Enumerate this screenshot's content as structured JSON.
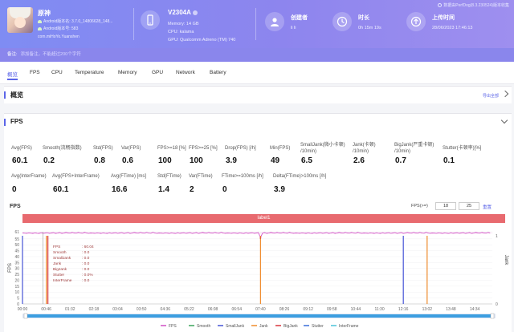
{
  "header": {
    "app_name": "原神",
    "version_line": "Android版本名: 3.7.0_14806628_148...",
    "version_code": "Android版本号: 583",
    "package": "com.miHoYo.Yuanshen",
    "device_name": "V2304A",
    "memory": "Memory: 14 GB",
    "cpu": "CPU: kalama",
    "gpu": "GPU: Qualcomm Adreno (TM) 740",
    "creator_label": "创建者",
    "creator_value": "li li",
    "duration_label": "时长",
    "duration_value": "0h 15m 19s",
    "upload_label": "上传时间",
    "upload_value": "28/06/2023 17:46:13",
    "watermark": "数据由PerfDog(8.3.230524)版本收集",
    "note_label": "备注:",
    "note_hint": "添加备注，不能超过200个字符",
    "accent_color": "#8a86ec"
  },
  "tabs": [
    "概览",
    "FPS",
    "CPU",
    "Temperature",
    "Memory",
    "GPU",
    "Network",
    "Battery"
  ],
  "overview": {
    "title": "概览",
    "export_label": "导出全部"
  },
  "fps_section": {
    "title": "FPS",
    "metrics_row1": [
      {
        "label": "Avg(FPS)",
        "value": "60.1"
      },
      {
        "label": "Smooth(流畅指数)",
        "value": "0.2"
      },
      {
        "label": "Std(FPS)",
        "value": "0.8"
      },
      {
        "label": "Var(FPS)",
        "value": "0.6"
      },
      {
        "label": "FPS>=18 [%]",
        "value": "100"
      },
      {
        "label": "FPS>=25 [%]",
        "value": "100"
      },
      {
        "label": "Drop(FPS) [/h]",
        "value": "3.9"
      },
      {
        "label": "Min(FPS)",
        "value": "49"
      },
      {
        "label": "SmallJank(微小卡顿)\n/10min)",
        "value": "6.5"
      },
      {
        "label": "Jank(卡顿)\n/10min)",
        "value": "2.6"
      },
      {
        "label": "BigJank(严重卡顿)\n/10min)",
        "value": "0.7"
      },
      {
        "label": "Stutter(卡顿率)[%]",
        "value": "0.1"
      }
    ],
    "metrics_row2": [
      {
        "label": "Avg(InterFrame)",
        "value": "0"
      },
      {
        "label": "Avg(FPS+InterFrame)",
        "value": "60.1"
      },
      {
        "label": "Avg(FTime) [ms]",
        "value": "16.6"
      },
      {
        "label": "Std(FTime)",
        "value": "1.4"
      },
      {
        "label": "Var(FTime)",
        "value": "2"
      },
      {
        "label": "FTime>=100ms [/h]",
        "value": "0"
      },
      {
        "label": "Delta(FTime)>100ms [/h]",
        "value": "3.9"
      }
    ]
  },
  "chart": {
    "title": "FPS",
    "fps_filter_label": "FPS(>=)",
    "fps_filter_values": [
      "18",
      "25"
    ],
    "reset_label": "重置",
    "label_bar": "label1"
  },
  "chart_data": {
    "type": "line",
    "ylabel_left": "FPS",
    "ylabel_right": "Jank",
    "y_ticks_left": [
      "61",
      "55",
      "50",
      "45",
      "40",
      "35",
      "30",
      "25",
      "20",
      "15",
      "10",
      "5",
      "0"
    ],
    "y_ticks_right": [
      "1",
      "0"
    ],
    "x_ticks": [
      "00:00",
      "00:46",
      "01:32",
      "02:18",
      "03:04",
      "03:50",
      "04:36",
      "05:22",
      "06:08",
      "06:54",
      "07:40",
      "08:26",
      "09:12",
      "09:58",
      "10:44",
      "11:30",
      "12:16",
      "13:02",
      "13:48",
      "14:34"
    ],
    "series": [
      {
        "name": "FPS",
        "color": "#d14fc4",
        "baseline": 60,
        "dips": [
          {
            "x": "00:46",
            "value": 49
          },
          {
            "x": "07:40",
            "value": 56
          },
          {
            "x": "13:02",
            "value": 58
          }
        ]
      },
      {
        "name": "Smooth",
        "color": "#3aa45a"
      },
      {
        "name": "SmallJank",
        "color": "#4554d6"
      },
      {
        "name": "Jank",
        "color": "#ef8a2b"
      },
      {
        "name": "BigJank",
        "color": "#d8363c"
      },
      {
        "name": "Stutter",
        "color": "#3b6ed8"
      },
      {
        "name": "InterFrame",
        "color": "#4bc2d8"
      }
    ],
    "jank_events": [
      {
        "x": "00:00",
        "type": "SmallJank"
      },
      {
        "x": "00:46",
        "type": "Jank"
      },
      {
        "x": "00:46",
        "type": "BigJank"
      },
      {
        "x": "07:40",
        "type": "Jank"
      },
      {
        "x": "12:16",
        "type": "SmallJank"
      },
      {
        "x": "13:02",
        "type": "Jank"
      }
    ],
    "tooltip": {
      "lines": [
        "FPS",
        "Smooth",
        "SmallJank",
        "Jank",
        "BigJank",
        "Stutter",
        "InterFrame"
      ],
      "values": [
        "60.04",
        "0.0",
        "0.0",
        "0.0",
        "0.0",
        "0.0%",
        "0.0"
      ]
    }
  }
}
